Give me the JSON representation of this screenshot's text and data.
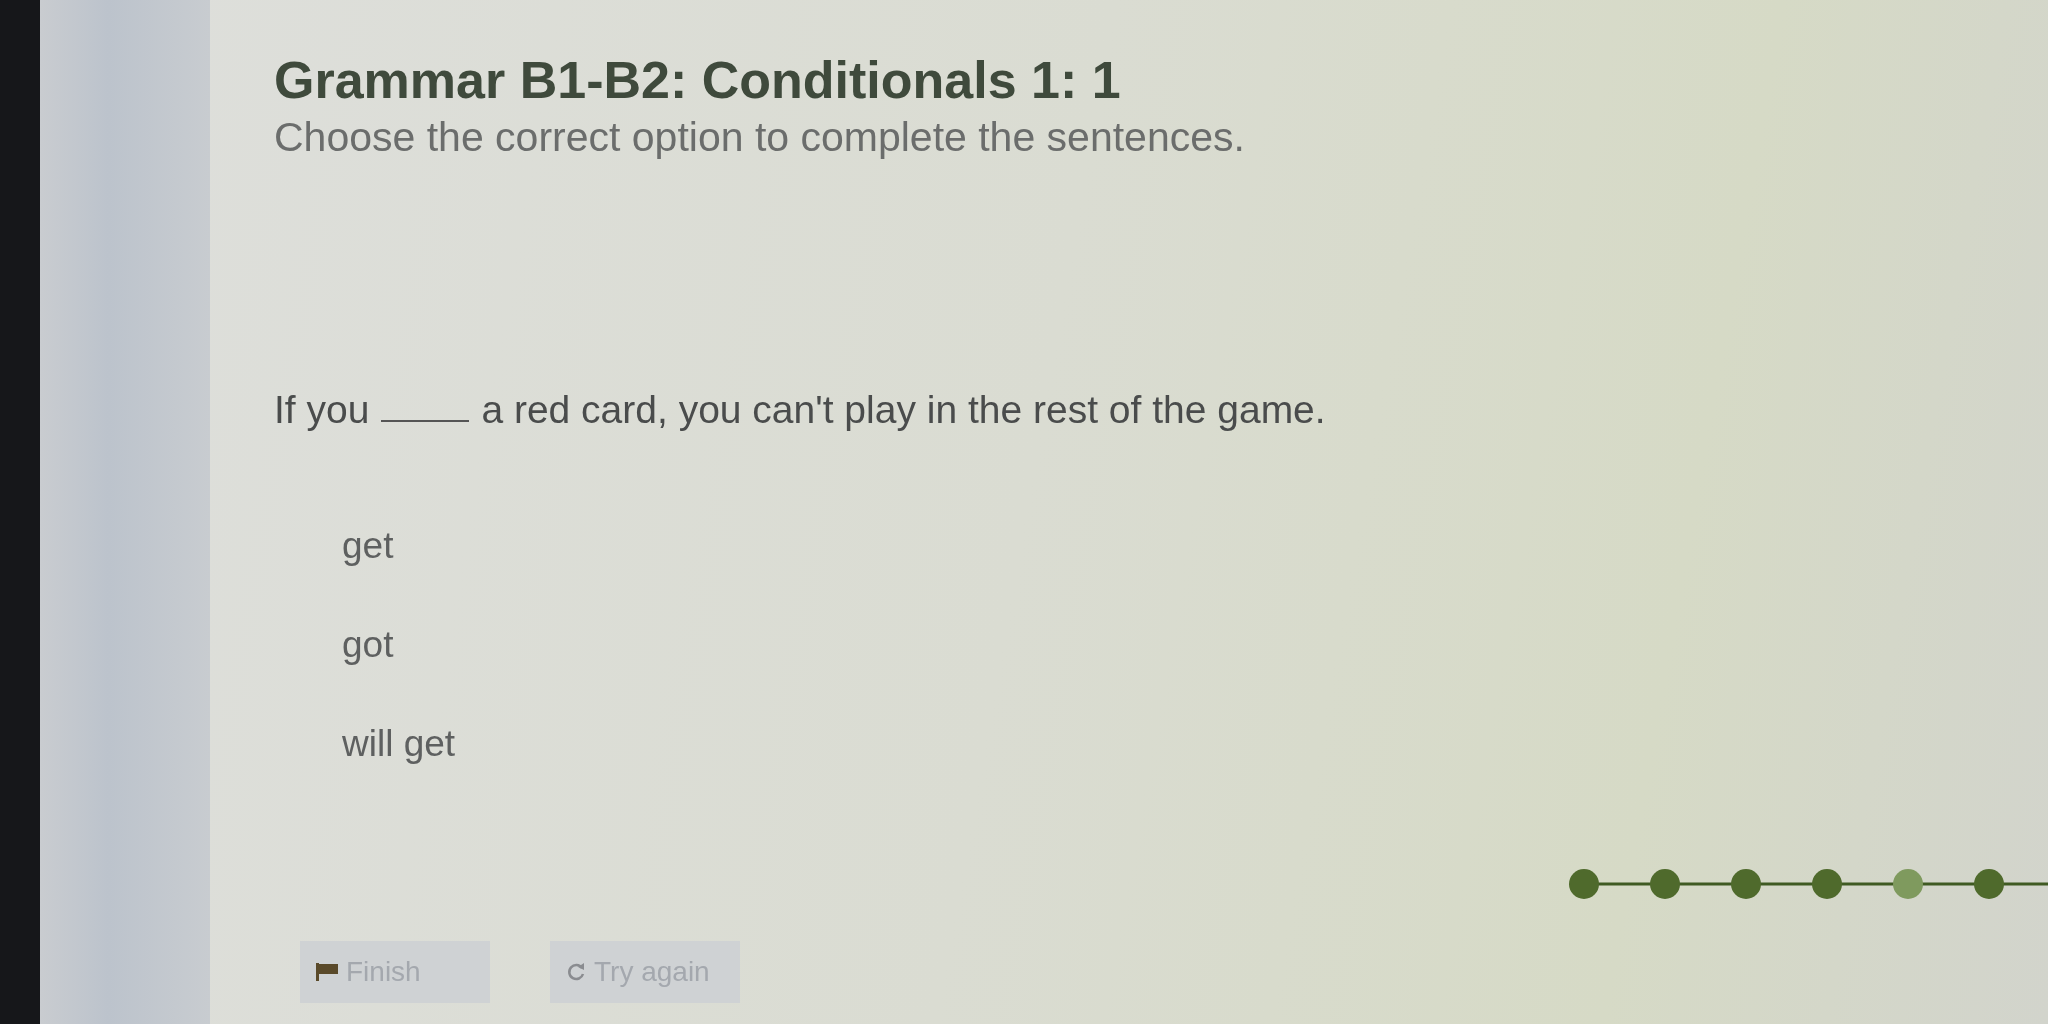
{
  "title": "Grammar B1-B2: Conditionals 1: 1",
  "instruction": "Choose the correct option to complete the sentences.",
  "question": {
    "before": "If you",
    "after": "a red card, you can't play in the rest of the game."
  },
  "options": [
    {
      "label": "get",
      "selected": false
    },
    {
      "label": "got",
      "selected": false
    },
    {
      "label": "will get",
      "selected": false
    }
  ],
  "progress": {
    "steps": [
      {
        "selected": false
      },
      {
        "selected": false
      },
      {
        "selected": false
      },
      {
        "selected": false
      },
      {
        "selected": true
      },
      {
        "selected": false
      }
    ]
  },
  "buttons": [
    {
      "kind": "finish",
      "label": "Finish",
      "disabled": true
    },
    {
      "kind": "retry",
      "label": "Try again",
      "disabled": true
    }
  ]
}
